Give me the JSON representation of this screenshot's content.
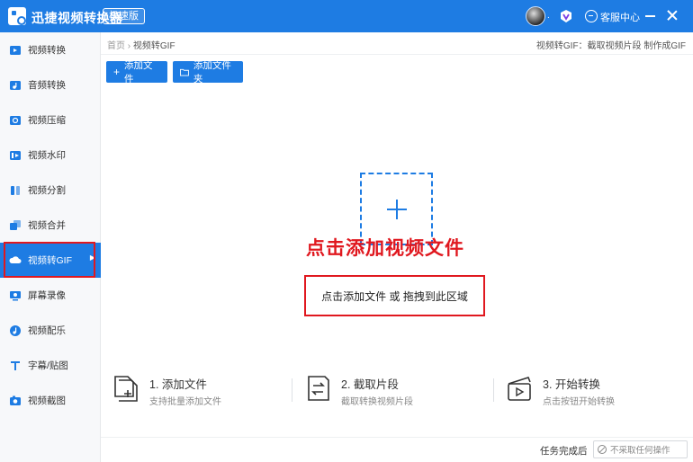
{
  "app": {
    "title": "迅捷视频转换器",
    "edition": "极速版",
    "service_label": "客服中心",
    "avatar_dot": "."
  },
  "colors": {
    "primary": "#1e7ce3",
    "highlight": "#e0181f",
    "sidebar_bg": "#f7f8fa"
  },
  "sidebar": {
    "items": [
      {
        "label": "视频转换",
        "icon": "video-convert-icon"
      },
      {
        "label": "音频转换",
        "icon": "audio-convert-icon"
      },
      {
        "label": "视频压缩",
        "icon": "video-compress-icon"
      },
      {
        "label": "视频水印",
        "icon": "video-watermark-icon"
      },
      {
        "label": "视频分割",
        "icon": "video-split-icon"
      },
      {
        "label": "视频合并",
        "icon": "video-merge-icon"
      },
      {
        "label": "视频转GIF",
        "icon": "video-to-gif-icon",
        "active": true
      },
      {
        "label": "屏幕录像",
        "icon": "screen-record-icon"
      },
      {
        "label": "视频配乐",
        "icon": "video-music-icon"
      },
      {
        "label": "字幕/贴图",
        "icon": "subtitle-sticker-icon"
      },
      {
        "label": "视频截图",
        "icon": "video-screenshot-icon"
      }
    ]
  },
  "breadcrumb": {
    "home": "首页",
    "sep": "›",
    "current": "视频转GIF"
  },
  "top_hint": "视频转GIF：截取视频片段 制作成GIF",
  "toolbar": {
    "add_file": "添加文件",
    "add_folder": "添加文件夹"
  },
  "dropzone": {
    "overlay_title": "点击添加视频文件",
    "hint": "点击添加文件 或 拖拽到此区域"
  },
  "steps": [
    {
      "title": "1. 添加文件",
      "desc": "支持批量添加文件",
      "icon": "add-file-icon"
    },
    {
      "title": "2. 截取片段",
      "desc": "截取转换视频片段",
      "icon": "cut-clip-icon"
    },
    {
      "title": "3. 开始转换",
      "desc": "点击按钮开始转换",
      "icon": "start-convert-icon"
    }
  ],
  "bottom": {
    "after_label": "任务完成后",
    "after_option": "不采取任何操作"
  }
}
